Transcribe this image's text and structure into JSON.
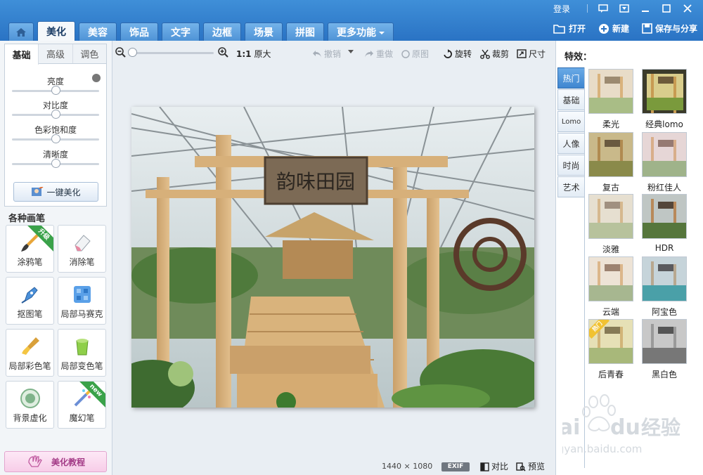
{
  "topbar": {
    "login": "登录",
    "tabs": [
      {
        "label": "",
        "name": "home"
      },
      {
        "label": "美化",
        "active": true
      },
      {
        "label": "美容"
      },
      {
        "label": "饰品"
      },
      {
        "label": "文字"
      },
      {
        "label": "边框"
      },
      {
        "label": "场景"
      },
      {
        "label": "拼图"
      },
      {
        "label": "更多功能",
        "dropdown": true
      }
    ],
    "open": "打开",
    "new": "新建",
    "save_share": "保存与分享"
  },
  "adjust": {
    "tabs": [
      "基础",
      "高级",
      "调色"
    ],
    "sliders": [
      {
        "label": "亮度",
        "value": 0.5
      },
      {
        "label": "对比度",
        "value": 0.5
      },
      {
        "label": "色彩饱和度",
        "value": 0.5
      },
      {
        "label": "清晰度",
        "value": 0.5
      }
    ],
    "one_key": "一键美化"
  },
  "brushes": {
    "title": "各种画笔",
    "items": [
      {
        "label": "涂鸦笔",
        "badge": "升级"
      },
      {
        "label": "消除笔"
      },
      {
        "label": "抠图笔"
      },
      {
        "label": "局部马赛克"
      },
      {
        "label": "局部彩色笔"
      },
      {
        "label": "局部变色笔"
      },
      {
        "label": "背景虚化"
      },
      {
        "label": "魔幻笔",
        "badge": "new"
      }
    ]
  },
  "tutorial": "美化教程",
  "toolbar": {
    "zoom_ratio": "1:1",
    "original_size": "原大",
    "undo": "撤销",
    "redo": "重做",
    "original": "原图",
    "rotate": "旋转",
    "crop": "裁剪",
    "size": "尺寸",
    "zoom_level": 0.0
  },
  "photo": {
    "sign_text": "韵味田园"
  },
  "status": {
    "width": "1440",
    "times": "×",
    "height": "1080",
    "exif": "EXIF",
    "compare": "对比",
    "preview": "预览"
  },
  "effects": {
    "title": "特效：",
    "tabs": [
      "热门",
      "基础",
      "Lomo",
      "人像",
      "时尚",
      "艺术"
    ],
    "items": [
      {
        "label": "柔光"
      },
      {
        "label": "经典lomo"
      },
      {
        "label": "复古"
      },
      {
        "label": "粉红佳人"
      },
      {
        "label": "淡雅"
      },
      {
        "label": "HDR"
      },
      {
        "label": "云端"
      },
      {
        "label": "阿宝色"
      },
      {
        "label": "后青春",
        "badge": "热门"
      },
      {
        "label": "黑白色"
      }
    ]
  },
  "watermark": {
    "brand": "Bai",
    "brand2": "du",
    "cn": "经验",
    "url": "jingyan.baidu.com"
  }
}
